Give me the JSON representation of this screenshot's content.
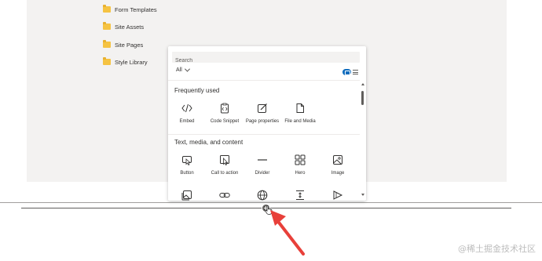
{
  "folders": [
    {
      "label": "Form Templates",
      "icon": "folder-icon"
    },
    {
      "label": "Site Assets",
      "icon": "folder-icon"
    },
    {
      "label": "Site Pages",
      "icon": "folder-icon"
    },
    {
      "label": "Style Library",
      "icon": "folder-icon"
    }
  ],
  "toolbox": {
    "search_placeholder": "Search",
    "filter_label": "All",
    "sections": {
      "frequent": "Frequently used",
      "text_media": "Text, media, and content"
    },
    "frequent_items": [
      {
        "label": "Embed",
        "icon": "embed-icon"
      },
      {
        "label": "Code Snippet",
        "icon": "code-snippet-icon"
      },
      {
        "label": "Page properties",
        "icon": "page-properties-icon"
      },
      {
        "label": "File and Media",
        "icon": "file-icon"
      }
    ],
    "content_items": [
      {
        "label": "Button",
        "icon": "button-icon"
      },
      {
        "label": "Call to action",
        "icon": "call-to-action-icon"
      },
      {
        "label": "Divider",
        "icon": "divider-icon"
      },
      {
        "label": "Hero",
        "icon": "hero-icon"
      },
      {
        "label": "Image",
        "icon": "image-icon"
      }
    ],
    "partial_items": [
      {
        "icon": "image-gallery-icon"
      },
      {
        "icon": "link-icon"
      },
      {
        "icon": "globe-icon"
      },
      {
        "icon": "spacer-icon"
      },
      {
        "icon": "stream-icon"
      }
    ]
  },
  "colors": {
    "accent": "#0f6cbd",
    "arrow": "#e8403a",
    "folder": "#f5c342"
  },
  "watermark": "@稀土掘金技术社区"
}
